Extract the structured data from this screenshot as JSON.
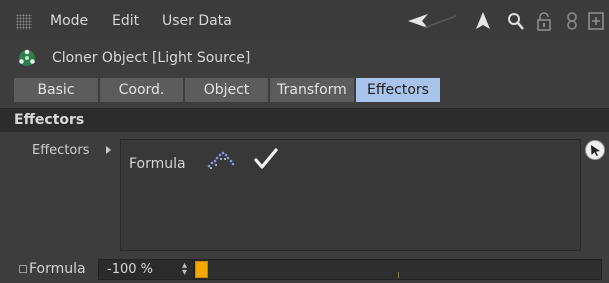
{
  "menubar": {
    "items": [
      "Mode",
      "Edit",
      "User Data"
    ],
    "icons": [
      "back-arrow-icon",
      "up-arrow-icon",
      "search-icon",
      "lock-icon",
      "link-icon",
      "new-panel-icon"
    ]
  },
  "object": {
    "title": "Cloner Object [Light Source]",
    "icon": "cloner-icon"
  },
  "tabs": [
    {
      "label": "Basic",
      "active": false
    },
    {
      "label": "Coord.",
      "active": false
    },
    {
      "label": "Object",
      "active": false
    },
    {
      "label": "Transform",
      "active": false
    },
    {
      "label": "Effectors",
      "active": true
    }
  ],
  "section": {
    "title": "Effectors"
  },
  "effectors": {
    "label": "Effectors",
    "items": [
      {
        "name": "Formula",
        "icon": "formula-wave-icon",
        "enabled": true
      }
    ]
  },
  "formula_param": {
    "label": "Formula",
    "value": "-100 %",
    "slider_position": 0.0
  },
  "colors": {
    "panel_bg": "#3d3d3d",
    "active_tab": "#a8c4ea",
    "slider_handle": "#f5a800"
  }
}
